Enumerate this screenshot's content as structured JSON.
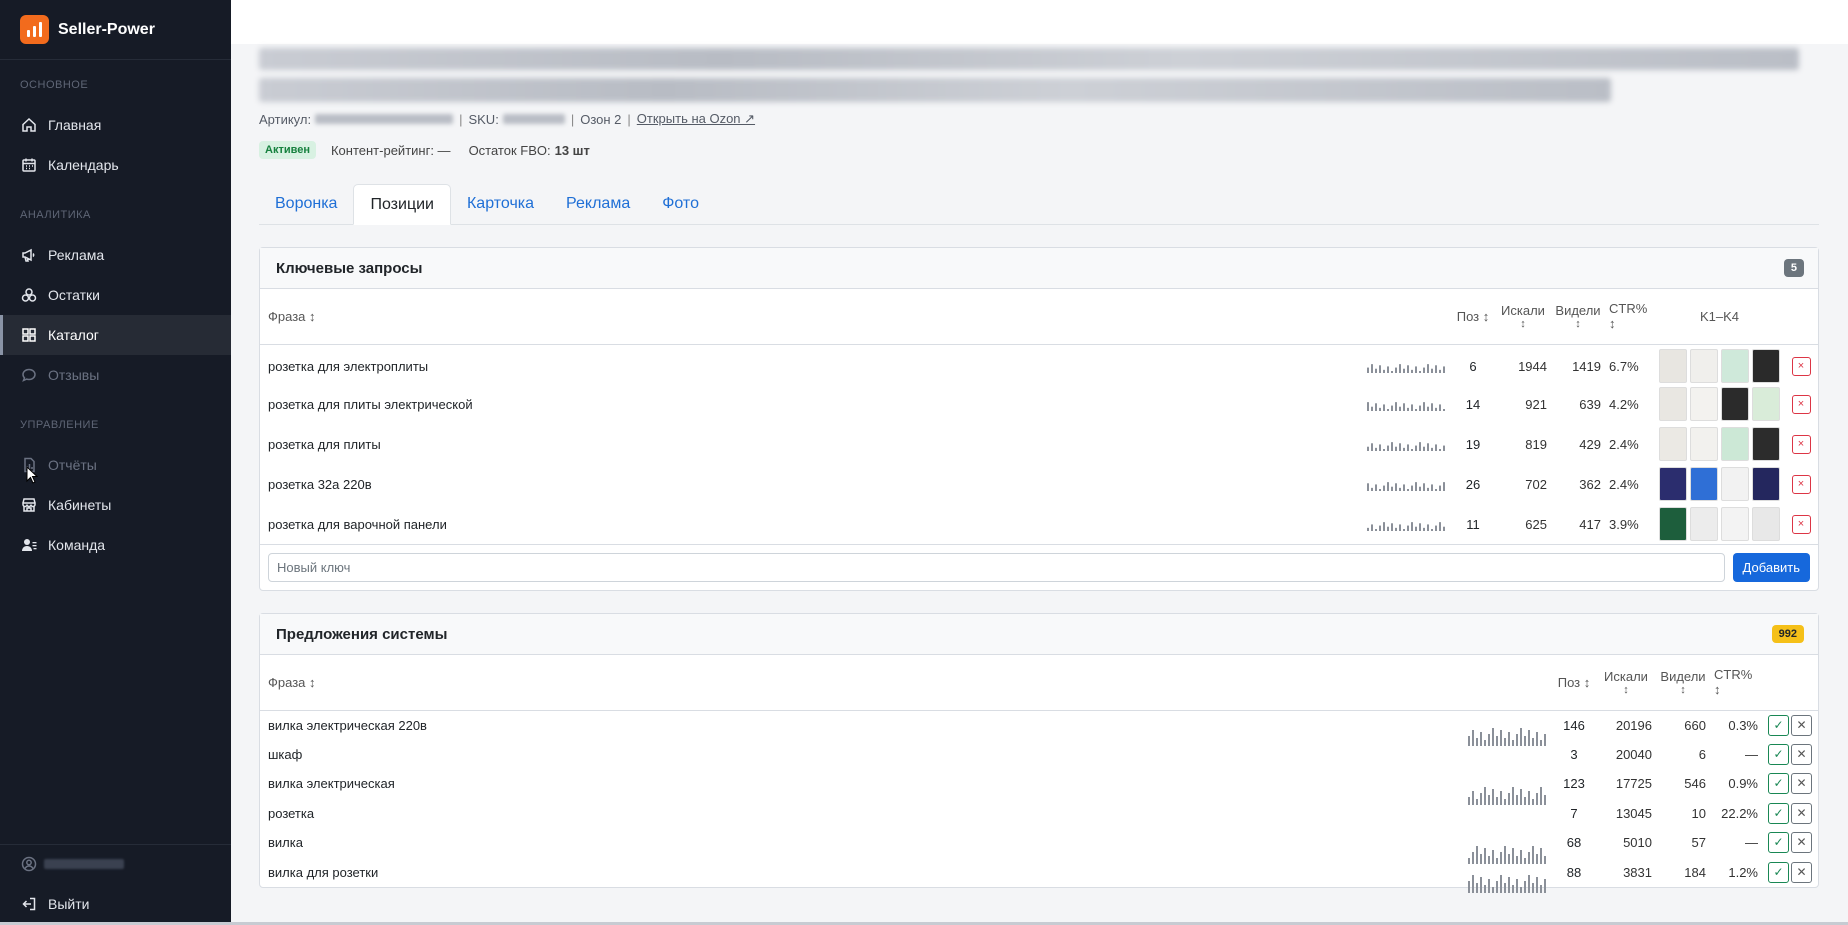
{
  "app": {
    "name": "Seller-Power"
  },
  "sidebar": {
    "sections": [
      {
        "title": "ОСНОВНОЕ",
        "items": [
          {
            "label": "Главная",
            "icon": "home-icon"
          },
          {
            "label": "Календарь",
            "icon": "calendar-icon"
          }
        ]
      },
      {
        "title": "АНАЛИТИКА",
        "items": [
          {
            "label": "Реклама",
            "icon": "megaphone-icon"
          },
          {
            "label": "Остатки",
            "icon": "boxes-icon"
          },
          {
            "label": "Каталог",
            "icon": "grid-icon",
            "active": true
          },
          {
            "label": "Отзывы",
            "icon": "chat-icon",
            "disabled": true
          }
        ]
      },
      {
        "title": "УПРАВЛЕНИЕ",
        "items": [
          {
            "label": "Отчёты",
            "icon": "report-icon",
            "disabled": true
          },
          {
            "label": "Кабинеты",
            "icon": "shop-icon"
          },
          {
            "label": "Команда",
            "icon": "team-icon"
          }
        ]
      }
    ],
    "logout_label": "Выйти"
  },
  "product": {
    "article_label": "Артикул:",
    "sku_label": "SKU:",
    "ozon_account": "Озон 2",
    "open_link": "Открыть на Ozon ↗",
    "status": "Активен",
    "content_rating": "Контент-рейтинг: —",
    "fbo_label": "Остаток FBO:",
    "fbo_value": "13 шт"
  },
  "tabs": [
    "Воронка",
    "Позиции",
    "Карточка",
    "Реклама",
    "Фото"
  ],
  "active_tab": 1,
  "keywords": {
    "title": "Ключевые запросы",
    "count": "5",
    "headers": {
      "phrase": "Фраза ↕",
      "pos": "Поз ↕",
      "searched": "Искали",
      "seen": "Видели",
      "ctr": "CTR% ↕",
      "top": "K1–K4",
      "sort": "↕"
    },
    "rows": [
      {
        "phrase": "розетка для электроплиты",
        "pos": "6",
        "searched": "1944",
        "seen": "1419",
        "ctr": "6.7%"
      },
      {
        "phrase": "розетка для плиты электрической",
        "pos": "14",
        "searched": "921",
        "seen": "639",
        "ctr": "4.2%"
      },
      {
        "phrase": "розетка для плиты",
        "pos": "19",
        "searched": "819",
        "seen": "429",
        "ctr": "2.4%"
      },
      {
        "phrase": "розетка 32а 220в",
        "pos": "26",
        "searched": "702",
        "seen": "362",
        "ctr": "2.4%"
      },
      {
        "phrase": "розетка для варочной панели",
        "pos": "11",
        "searched": "625",
        "seen": "417",
        "ctr": "3.9%"
      }
    ],
    "new_placeholder": "Новый ключ",
    "add_label": "Добавить",
    "remove_glyph": "×"
  },
  "suggestions": {
    "title": "Предложения системы",
    "count": "992",
    "headers": {
      "phrase": "Фраза ↕",
      "pos": "Поз ↕",
      "searched": "Искали",
      "seen": "Видели",
      "ctr": "CTR% ↕",
      "sort": "↕"
    },
    "rows": [
      {
        "phrase": "вилка электрическая 220в",
        "pos": "146",
        "searched": "20196",
        "seen": "660",
        "ctr": "0.3%"
      },
      {
        "phrase": "шкаф",
        "pos": "3",
        "searched": "20040",
        "seen": "6",
        "ctr": "—"
      },
      {
        "phrase": "вилка электрическая",
        "pos": "123",
        "searched": "17725",
        "seen": "546",
        "ctr": "0.9%"
      },
      {
        "phrase": "розетка",
        "pos": "7",
        "searched": "13045",
        "seen": "10",
        "ctr": "22.2%"
      },
      {
        "phrase": "вилка",
        "pos": "68",
        "searched": "5010",
        "seen": "57",
        "ctr": "—"
      },
      {
        "phrase": "вилка для розетки",
        "pos": "88",
        "searched": "3831",
        "seen": "184",
        "ctr": "1.2%"
      }
    ],
    "accept_glyph": "✓",
    "reject_glyph": "✕"
  },
  "colors": {
    "brand": "#f26b1d",
    "sidebar_bg": "#161b26",
    "link": "#1f6fd6",
    "accent": "#1668dc",
    "success": "#198754",
    "danger": "#dc3545",
    "warning": "#f5c018"
  }
}
